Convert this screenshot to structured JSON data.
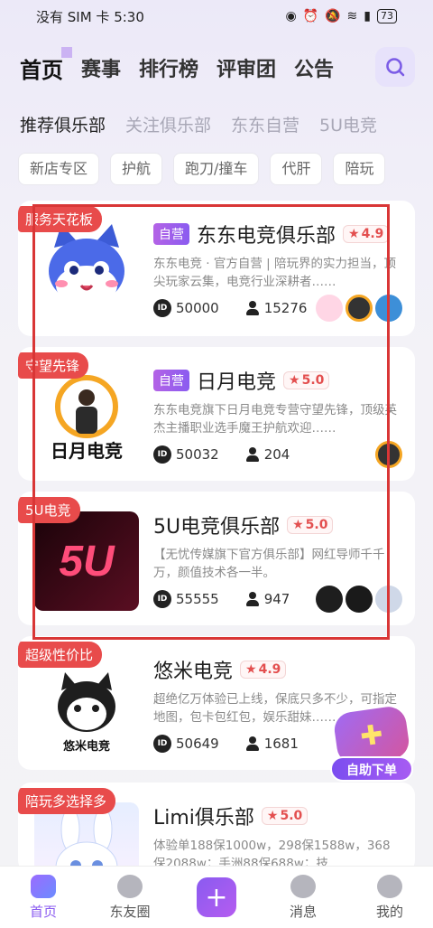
{
  "status_bar": {
    "carrier_time": "没有 SIM 卡 5:30",
    "battery": "73"
  },
  "top_nav": {
    "items": [
      "首页",
      "赛事",
      "排行榜",
      "评审团",
      "公告"
    ]
  },
  "category_tabs": [
    "推荐俱乐部",
    "关注俱乐部",
    "东东自营",
    "5U电竞"
  ],
  "filter_chips": [
    "新店专区",
    "护航",
    "跑刀/撞车",
    "代肝",
    "陪玩"
  ],
  "clubs": [
    {
      "tag": "服务天花板",
      "self_badge": "自营",
      "name": "东东电竞俱乐部",
      "rating": "4.9",
      "desc": "东东电竞 · 官方自营 | 陪玩界的实力担当，顶尖玩家云集，电竞行业深耕者……",
      "id": "50000",
      "members": "15276",
      "thumb_color": "#3c5bd6"
    },
    {
      "tag": "守望先锋",
      "self_badge": "自营",
      "name": "日月电竞",
      "rating": "5.0",
      "desc": "东东电竞旗下日月电竞专营守望先锋，顶级英杰主播职业选手魔王护航欢迎……",
      "id": "50032",
      "members": "204",
      "thumb_color": "#ffffff",
      "thumb_text": "日月电竞"
    },
    {
      "tag": "5U电竞",
      "self_badge": "",
      "name": "5U电竞俱乐部",
      "rating": "5.0",
      "desc": "【无忧传媒旗下官方俱乐部】网红导师千千万，颜值技术各一半。",
      "id": "55555",
      "members": "947",
      "thumb_color": "#2a0612",
      "thumb_text": "5U"
    },
    {
      "tag": "超级性价比",
      "self_badge": "",
      "name": "悠米电竞",
      "rating": "4.9",
      "desc": "超绝亿万体验已上线，保底只多不少，可指定地图，包卡包红包，娱乐甜妹……",
      "id": "50649",
      "members": "1681",
      "thumb_color": "#ffffff",
      "thumb_text": "悠米电竞"
    },
    {
      "tag": "陪玩多选择多",
      "self_badge": "",
      "name": "Limi俱乐部",
      "rating": "5.0",
      "desc": "体验单188保1000w，298保1588w，368保2088w；手洲88保688w；技……",
      "id": "",
      "members": "",
      "thumb_color": "#dfe9ff"
    }
  ],
  "floating_button": {
    "label": "自助下单",
    "icon": "gamepad-icon"
  },
  "bottom_nav": {
    "home": "首页",
    "friends": "东友圈",
    "add": "+",
    "messages": "消息",
    "mine": "我的"
  },
  "colors": {
    "accent": "#8a5bf0",
    "tag_red": "#e84b4b",
    "outline_red": "#d93636"
  }
}
